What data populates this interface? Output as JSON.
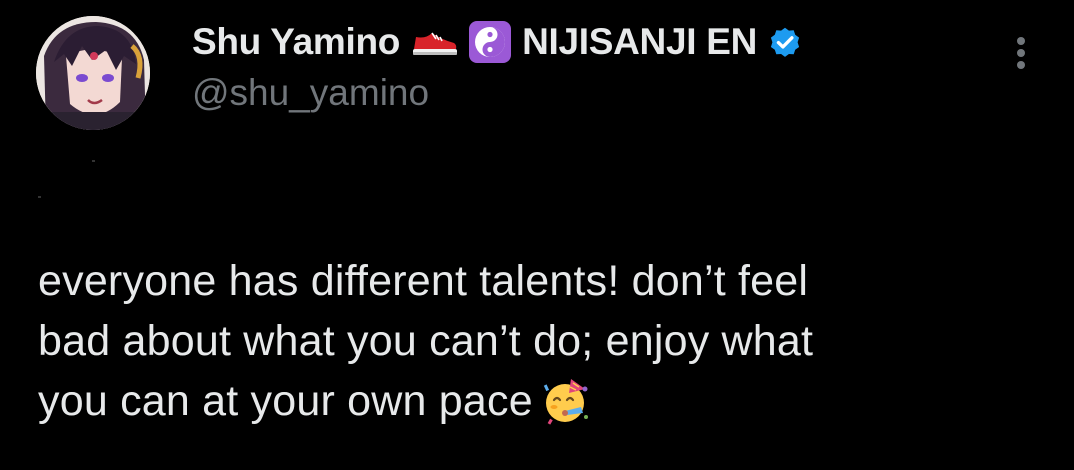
{
  "author": {
    "display_name": "Shu Yamino",
    "name_emoji_icons": [
      "sneaker-icon",
      "yin-yang-icon"
    ],
    "affiliation": "NIJISANJI EN",
    "verified": true,
    "handle": "@shu_yamino"
  },
  "tweet": {
    "lines": [
      "everyone has different talents! don’t feel",
      "bad about what you can’t do; enjoy what",
      "you can at your own pace"
    ],
    "trailing_emoji": "partying-face-icon"
  },
  "colors": {
    "background": "#000000",
    "primary_text": "#e7e9ea",
    "secondary_text": "#71767b",
    "verified_badge": "#1d9bf0",
    "yin_yang_badge": "#9b59d6"
  }
}
